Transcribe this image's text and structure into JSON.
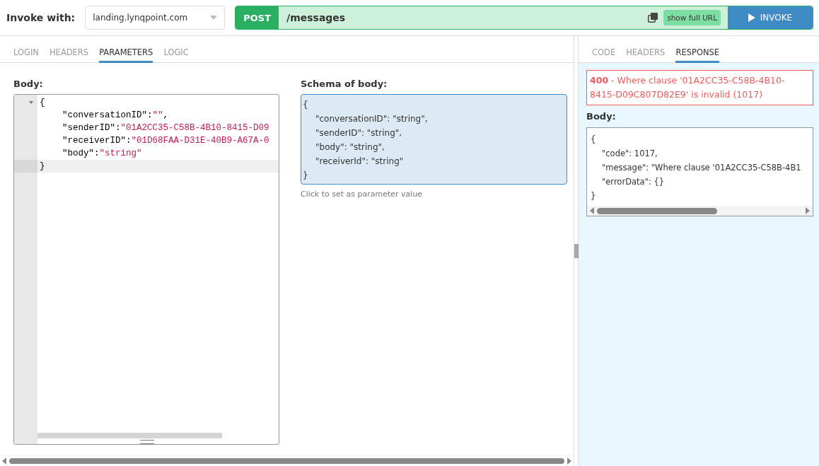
{
  "invoke": {
    "label": "Invoke with:",
    "host": "landing.lynqpoint.com",
    "method": "POST",
    "path": "/messages",
    "show_full_url": "show full URL",
    "button": "INVOKE"
  },
  "left_tabs": [
    {
      "label": "LOGIN",
      "selected": false
    },
    {
      "label": "HEADERS",
      "selected": false
    },
    {
      "label": "PARAMETERS",
      "selected": true
    },
    {
      "label": "LOGIC",
      "selected": false
    }
  ],
  "body": {
    "label": "Body:",
    "lines": [
      {
        "key": "{",
        "active": false,
        "fold": true,
        "indent": false
      },
      {
        "key": "\"conversationID\": ",
        "value": "\"\"",
        "trail": ",",
        "active": false,
        "fold": false,
        "indent": true
      },
      {
        "key": "\"senderID\": ",
        "value": "\"01A2CC35-C58B-4B10-8415-D09",
        "active": false,
        "fold": false,
        "indent": true
      },
      {
        "key": "\"receiverID\": ",
        "value": "\"01D68FAA-D31E-40B9-A67A-0",
        "active": false,
        "fold": false,
        "indent": true
      },
      {
        "key": "\"body\": ",
        "value": "\"string\"",
        "active": false,
        "fold": false,
        "indent": true
      },
      {
        "key": "}",
        "active": true,
        "fold": false,
        "indent": false
      }
    ]
  },
  "schema": {
    "label": "Schema of body:",
    "lines": [
      {
        "text": "{",
        "indent": false
      },
      {
        "text": "\"conversationID\": \"string\",",
        "indent": true
      },
      {
        "text": "\"senderID\": \"string\",",
        "indent": true
      },
      {
        "text": "\"body\": \"string\",",
        "indent": true
      },
      {
        "text": "\"receiverId\": \"string\"",
        "indent": true
      },
      {
        "text": "}",
        "indent": false
      }
    ],
    "hint": "Click to set as parameter value"
  },
  "right_tabs": [
    {
      "label": "CODE",
      "selected": false
    },
    {
      "label": "HEADERS",
      "selected": false
    },
    {
      "label": "RESPONSE",
      "selected": true
    }
  ],
  "response": {
    "status": "400",
    "message": " - Where clause '01A2CC35-C58B-4B10-8415-D09C807D82E9' is invalid  (1017)",
    "body_label": "Body:",
    "lines": [
      {
        "text": "{",
        "indent": false
      },
      {
        "text": "\"code\": 1017,",
        "indent": true
      },
      {
        "text": "\"message\": \"Where clause '01A2CC35-C58B-4B1",
        "indent": true
      },
      {
        "text": "\"errorData\": {}",
        "indent": true
      },
      {
        "text": "}",
        "indent": false
      }
    ]
  }
}
